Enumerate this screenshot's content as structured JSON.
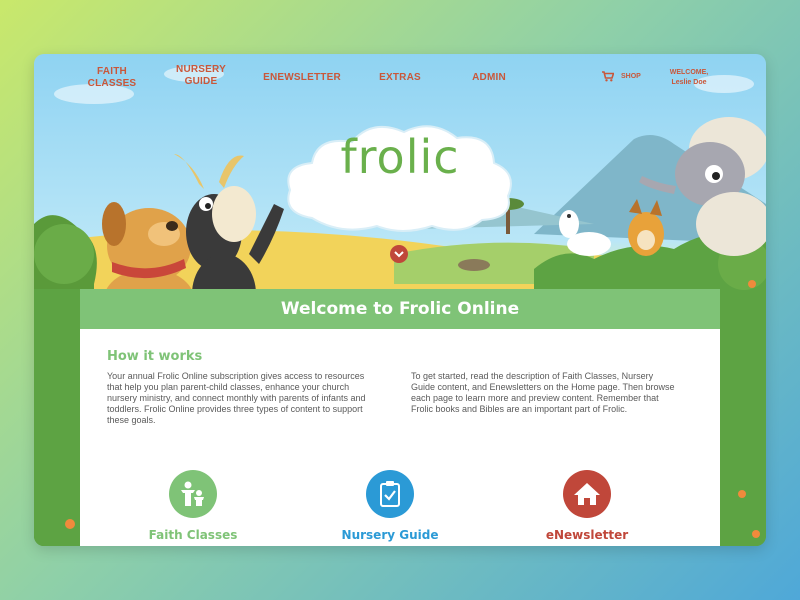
{
  "colors": {
    "accent_green": "#7fc377",
    "nav_red": "#c9573a",
    "faith_green": "#7fc377",
    "nursery_blue": "#2b9ad6",
    "enews_red": "#c0473a",
    "logo_green": "#6ab04c"
  },
  "nav": {
    "faith": "FAITH CLASSES",
    "nursery": "NURSERY GUIDE",
    "enewsletter": "ENEWSLETTER",
    "extras": "EXTRAS",
    "admin": "ADMIN",
    "shop": "SHOP",
    "welcome": "WELCOME,",
    "user": "Leslie Doe",
    "cart_icon": "cart-icon"
  },
  "hero": {
    "logo": "frolic",
    "scroll_icon": "chevron-down-icon"
  },
  "panel": {
    "title": "Welcome to Frolic Online",
    "how_title": "How it works",
    "left_text": "Your annual Frolic Online subscription gives access to resources that help you plan parent-child classes, enhance your church nursery ministry, and connect monthly with parents of infants and toddlers. Frolic Online provides three types of content to support these goals.",
    "right_text": "To get started, read the description of Faith Classes, Nursery Guide content, and Enewsletters on the Home page. Then browse each page to learn more and preview content. Remember that Frolic books and Bibles are an important part of Frolic."
  },
  "features": [
    {
      "label": "Faith Classes",
      "icon": "parent-child-icon"
    },
    {
      "label": "Nursery Guide",
      "icon": "clipboard-check-icon"
    },
    {
      "label": "eNewsletter",
      "icon": "home-icon"
    }
  ]
}
